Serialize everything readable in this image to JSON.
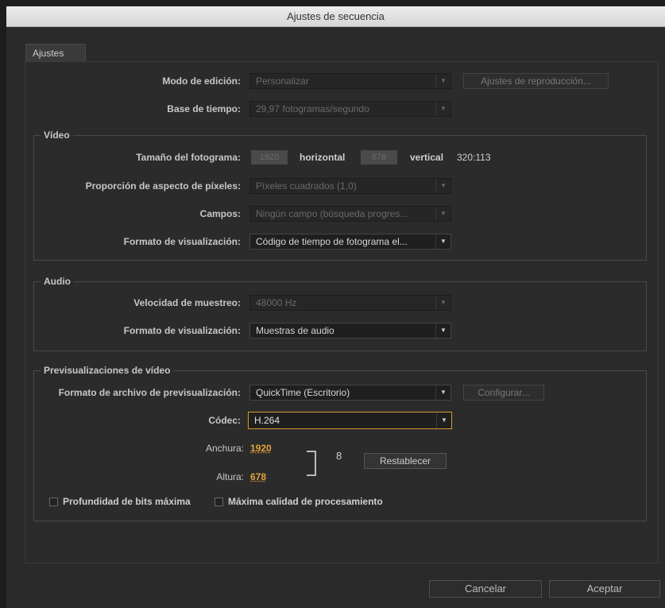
{
  "window": {
    "title": "Ajustes de secuencia"
  },
  "tab": {
    "label": "Ajustes"
  },
  "general": {
    "edit_mode_label": "Modo de edición:",
    "edit_mode_value": "Personalizar",
    "playback_settings_button": "Ajustes de reproducción...",
    "timebase_label": "Base de tiempo:",
    "timebase_value": "29,97 fotogramas/segundo"
  },
  "video": {
    "title": "Vídeo",
    "frame_size_label": "Tamaño del fotograma:",
    "frame_width": "1920",
    "horizontal_label": "horizontal",
    "frame_height": "678",
    "vertical_label": "vertical",
    "aspect": "320:113",
    "pixel_aspect_label": "Proporción de aspecto de píxeles:",
    "pixel_aspect_value": "Píxeles cuadrados (1,0)",
    "fields_label": "Campos:",
    "fields_value": "Ningún campo (búsqueda progres...",
    "display_format_label": "Formato de visualización:",
    "display_format_value": "Código de tiempo de fotograma el..."
  },
  "audio": {
    "title": "Audio",
    "sample_rate_label": "Velocidad de muestreo:",
    "sample_rate_value": "48000 Hz",
    "display_format_label": "Formato de visualización:",
    "display_format_value": "Muestras de audio"
  },
  "previews": {
    "title": "Previsualizaciones de vídeo",
    "file_format_label": "Formato de archivo de previsualización:",
    "file_format_value": "QuickTime (Escritorio)",
    "configure_button": "Configurar...",
    "codec_label": "Códec:",
    "codec_value": "H.264",
    "width_label": "Anchura:",
    "width_value": "1920",
    "height_label": "Altura:",
    "height_value": "678",
    "reset_button": "Restablecer",
    "max_bit_depth_label": "Profundidad de bits máxima",
    "max_render_quality_label": "Máxima calidad de procesamiento"
  },
  "footer": {
    "cancel": "Cancelar",
    "accept": "Aceptar"
  },
  "icons": {
    "dropdown_arrow": "▼",
    "link": "8"
  },
  "colors": {
    "accent": "#e3a33a",
    "background": "#2b2b2b"
  }
}
